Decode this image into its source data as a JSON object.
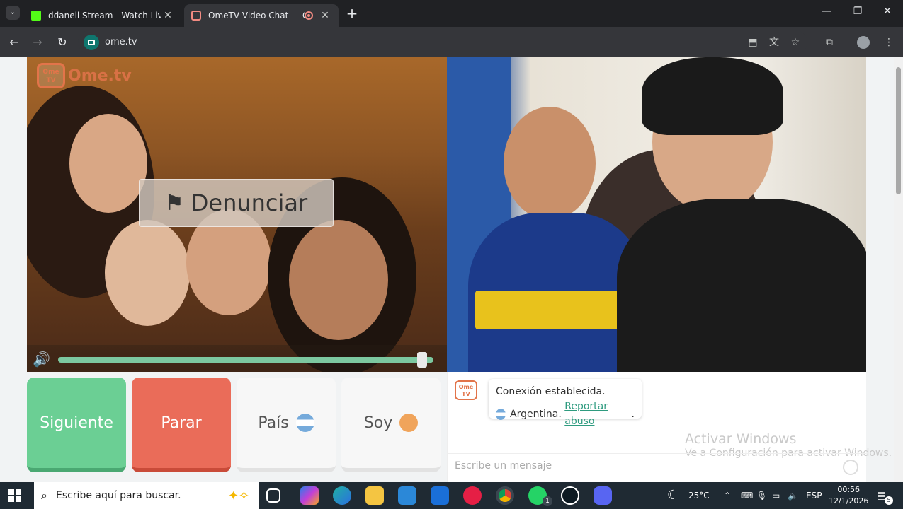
{
  "browser": {
    "tabs": [
      {
        "title": "ddanell Stream - Watch Live on",
        "close": "✕"
      },
      {
        "title": "OmeTV Video Chat — Ome",
        "close": "✕"
      }
    ],
    "new_tab": "+",
    "url": "ome.tv"
  },
  "ometv": {
    "logo_badge": "Ome TV",
    "logo_text": "Ome.tv",
    "report_button": "Denunciar",
    "buttons": {
      "next": "Siguiente",
      "stop": "Parar",
      "country": "País",
      "me": "Soy"
    },
    "volume_fraction": 0.97,
    "chat": {
      "status": "Conexión establecida.",
      "country": "Argentina.",
      "report_link": "Reportar abuso",
      "report_suffix": ".",
      "placeholder": "Escribe un mensaje"
    }
  },
  "windows_watermark": {
    "line1": "Activar Windows",
    "line2": "Ve a Configuración para activar Windows."
  },
  "taskbar": {
    "search_placeholder": "Escribe aquí para buscar.",
    "weather": "25°C",
    "language": "ESP",
    "time": "00:56",
    "date": "12/1/2026",
    "whatsapp_badge": "1",
    "notifications": "5"
  },
  "colors": {
    "next": "#6bcf94",
    "stop": "#ea6c59",
    "accent": "#e2744a",
    "link": "#2e9b7f"
  }
}
